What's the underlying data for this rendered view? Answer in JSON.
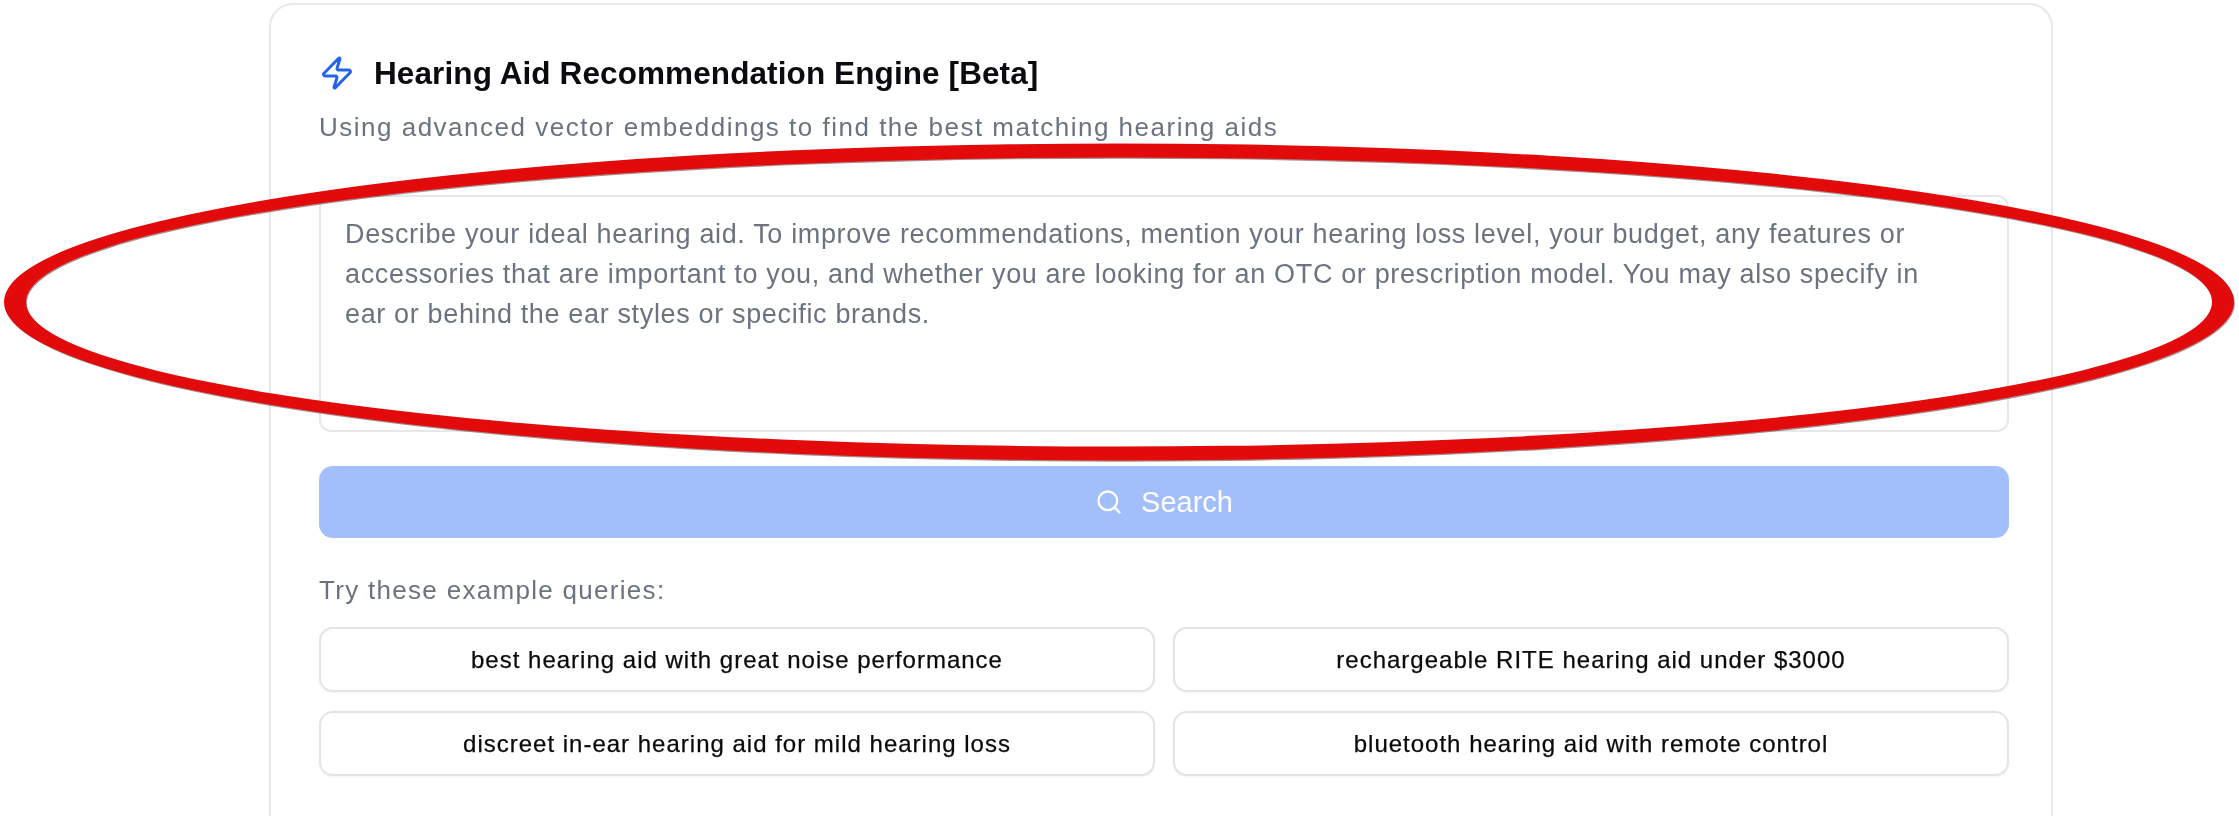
{
  "card": {
    "title": "Hearing Aid Recommendation Engine [Beta]",
    "subtitle": "Using advanced vector embeddings to find the best matching hearing aids"
  },
  "query_field": {
    "placeholder": "Describe your ideal hearing aid. To improve recommendations, mention your hearing loss level, your budget, any features or accessories that are important to you, and whether you are looking for an OTC or prescription model. You may also specify in ear or behind the ear styles or specific brands."
  },
  "search_button": {
    "label": "Search",
    "disabled": true
  },
  "examples": {
    "heading": "Try these example queries:",
    "queries": [
      "best hearing aid with great noise performance",
      "rechargeable RITE hearing aid under $3000",
      "discreet in-ear hearing aid for mild hearing loss",
      "bluetooth hearing aid with remote control"
    ]
  },
  "annotation": {
    "kind": "ellipse"
  }
}
